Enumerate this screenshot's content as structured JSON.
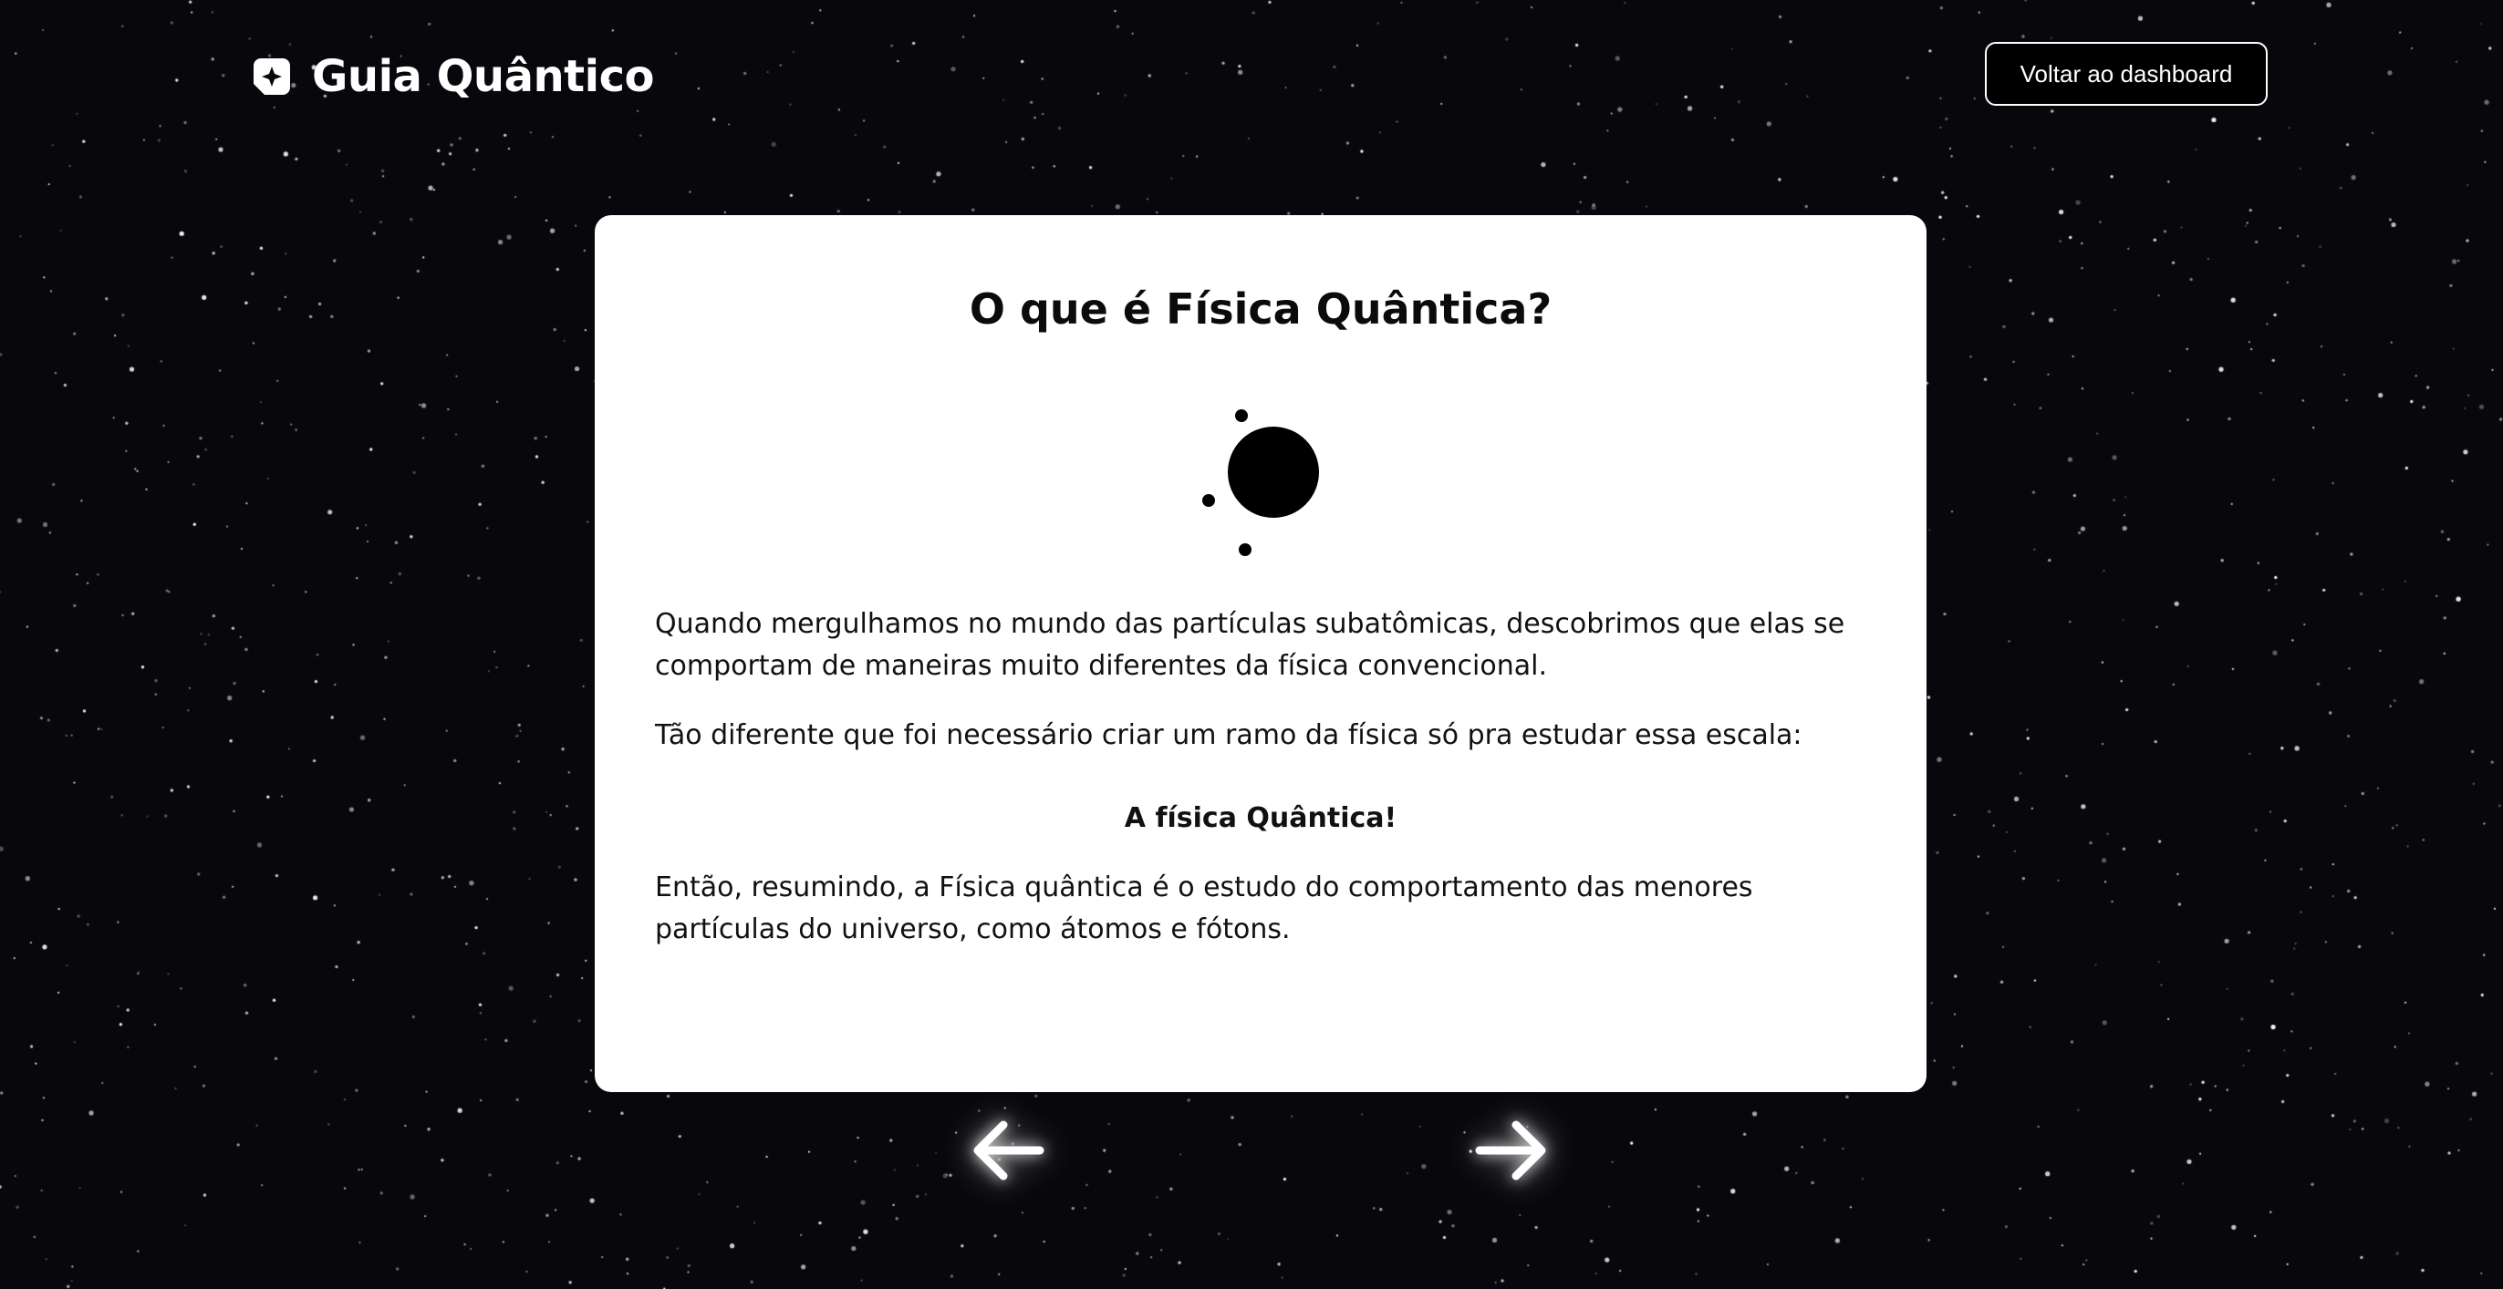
{
  "header": {
    "brand_name": "Guia Quântico",
    "brand_icon": "sparkle-badge-icon",
    "back_button_label": "Voltar ao dashboard"
  },
  "card": {
    "title": "O que é Física Quântica?",
    "illustration": "atom-icon",
    "paragraphs": {
      "p1": "Quando mergulhamos no mundo das partículas subatômicas, descobrimos que elas se comportam de maneiras muito diferentes da física convencional.",
      "p2": "Tão diferente que foi necessário criar um ramo da física só pra estudar essa escala:",
      "p3": "A física Quântica!",
      "p4": "Então, resumindo, a Física quântica é o estudo do comportamento das menores partículas do universo, como átomos e fótons."
    }
  },
  "navigation": {
    "prev_icon": "arrow-left-icon",
    "next_icon": "arrow-right-icon"
  },
  "colors": {
    "background": "#07070c",
    "card": "#ffffff",
    "text": "#111111",
    "accent": "#ffffff"
  }
}
